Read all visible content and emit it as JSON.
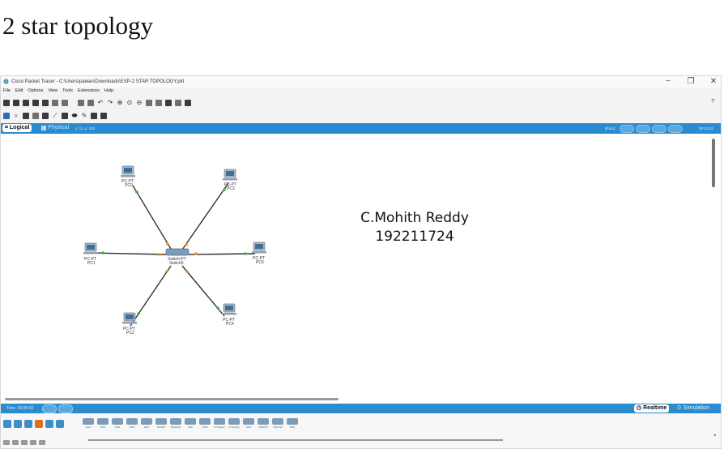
{
  "doc_title": "2 star topology",
  "window": {
    "title": "Cisco Packet Tracer - C:\\Users\\pawan\\Downloads\\EXP-2 STAR TOPOLOGY.pkt",
    "minimize": "−",
    "maximize": "❐",
    "close": "✕"
  },
  "menu": [
    "File",
    "Edit",
    "Options",
    "View",
    "Tools",
    "Extensions",
    "Help"
  ],
  "help_label": "?",
  "tabs": {
    "logical": "Logical",
    "physical": "Physical",
    "coords": "x: 11, y: 463"
  },
  "root_label": "[Root]",
  "mode_time": "00:01:03",
  "network": {
    "switch": {
      "model": "Switch-PT",
      "name": "Switch0"
    },
    "pcs": [
      {
        "model": "PC-PT",
        "name": "PC0"
      },
      {
        "model": "PC-PT",
        "name": "PC3"
      },
      {
        "model": "PC-PT",
        "name": "PC1"
      },
      {
        "model": "PC-PT",
        "name": "PC5"
      },
      {
        "model": "PC-PT",
        "name": "PC2"
      },
      {
        "model": "PC-PT",
        "name": "PC4"
      }
    ]
  },
  "overlay": {
    "name": "C.Mohith Reddy",
    "id": "192211724"
  },
  "timebar": {
    "time": "Time: 00:00:03",
    "realtime": "Realtime",
    "simulation": "Simulation"
  },
  "devices": [
    "4321",
    "4331",
    "1941",
    "2901",
    "2911",
    "819IOX",
    "819HGW",
    "829",
    "1240",
    "PT-Router",
    "PT-Empty",
    "1841",
    "2620XM",
    "2621XM",
    "2811"
  ],
  "colors": {
    "accent": "#2a8bd1",
    "link": "#333333",
    "link_up": "#3bb03b",
    "link_amber": "#f08a1c"
  },
  "icons": {
    "app": "packet-tracer-icon",
    "pc": "pc-icon",
    "switch": "switch-icon"
  }
}
